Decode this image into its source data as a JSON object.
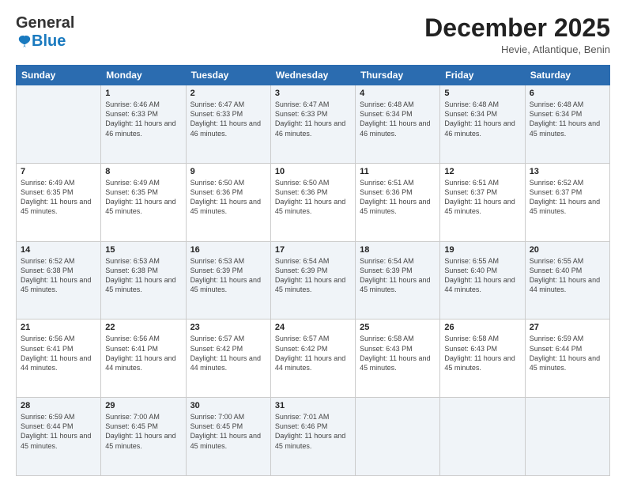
{
  "logo": {
    "general": "General",
    "blue": "Blue"
  },
  "title": "December 2025",
  "location": "Hevie, Atlantique, Benin",
  "days_of_week": [
    "Sunday",
    "Monday",
    "Tuesday",
    "Wednesday",
    "Thursday",
    "Friday",
    "Saturday"
  ],
  "weeks": [
    [
      {
        "day": "",
        "sunrise": "",
        "sunset": "",
        "daylight": ""
      },
      {
        "day": "1",
        "sunrise": "Sunrise: 6:46 AM",
        "sunset": "Sunset: 6:33 PM",
        "daylight": "Daylight: 11 hours and 46 minutes."
      },
      {
        "day": "2",
        "sunrise": "Sunrise: 6:47 AM",
        "sunset": "Sunset: 6:33 PM",
        "daylight": "Daylight: 11 hours and 46 minutes."
      },
      {
        "day": "3",
        "sunrise": "Sunrise: 6:47 AM",
        "sunset": "Sunset: 6:33 PM",
        "daylight": "Daylight: 11 hours and 46 minutes."
      },
      {
        "day": "4",
        "sunrise": "Sunrise: 6:48 AM",
        "sunset": "Sunset: 6:34 PM",
        "daylight": "Daylight: 11 hours and 46 minutes."
      },
      {
        "day": "5",
        "sunrise": "Sunrise: 6:48 AM",
        "sunset": "Sunset: 6:34 PM",
        "daylight": "Daylight: 11 hours and 46 minutes."
      },
      {
        "day": "6",
        "sunrise": "Sunrise: 6:48 AM",
        "sunset": "Sunset: 6:34 PM",
        "daylight": "Daylight: 11 hours and 45 minutes."
      }
    ],
    [
      {
        "day": "7",
        "sunrise": "Sunrise: 6:49 AM",
        "sunset": "Sunset: 6:35 PM",
        "daylight": "Daylight: 11 hours and 45 minutes."
      },
      {
        "day": "8",
        "sunrise": "Sunrise: 6:49 AM",
        "sunset": "Sunset: 6:35 PM",
        "daylight": "Daylight: 11 hours and 45 minutes."
      },
      {
        "day": "9",
        "sunrise": "Sunrise: 6:50 AM",
        "sunset": "Sunset: 6:36 PM",
        "daylight": "Daylight: 11 hours and 45 minutes."
      },
      {
        "day": "10",
        "sunrise": "Sunrise: 6:50 AM",
        "sunset": "Sunset: 6:36 PM",
        "daylight": "Daylight: 11 hours and 45 minutes."
      },
      {
        "day": "11",
        "sunrise": "Sunrise: 6:51 AM",
        "sunset": "Sunset: 6:36 PM",
        "daylight": "Daylight: 11 hours and 45 minutes."
      },
      {
        "day": "12",
        "sunrise": "Sunrise: 6:51 AM",
        "sunset": "Sunset: 6:37 PM",
        "daylight": "Daylight: 11 hours and 45 minutes."
      },
      {
        "day": "13",
        "sunrise": "Sunrise: 6:52 AM",
        "sunset": "Sunset: 6:37 PM",
        "daylight": "Daylight: 11 hours and 45 minutes."
      }
    ],
    [
      {
        "day": "14",
        "sunrise": "Sunrise: 6:52 AM",
        "sunset": "Sunset: 6:38 PM",
        "daylight": "Daylight: 11 hours and 45 minutes."
      },
      {
        "day": "15",
        "sunrise": "Sunrise: 6:53 AM",
        "sunset": "Sunset: 6:38 PM",
        "daylight": "Daylight: 11 hours and 45 minutes."
      },
      {
        "day": "16",
        "sunrise": "Sunrise: 6:53 AM",
        "sunset": "Sunset: 6:39 PM",
        "daylight": "Daylight: 11 hours and 45 minutes."
      },
      {
        "day": "17",
        "sunrise": "Sunrise: 6:54 AM",
        "sunset": "Sunset: 6:39 PM",
        "daylight": "Daylight: 11 hours and 45 minutes."
      },
      {
        "day": "18",
        "sunrise": "Sunrise: 6:54 AM",
        "sunset": "Sunset: 6:39 PM",
        "daylight": "Daylight: 11 hours and 45 minutes."
      },
      {
        "day": "19",
        "sunrise": "Sunrise: 6:55 AM",
        "sunset": "Sunset: 6:40 PM",
        "daylight": "Daylight: 11 hours and 44 minutes."
      },
      {
        "day": "20",
        "sunrise": "Sunrise: 6:55 AM",
        "sunset": "Sunset: 6:40 PM",
        "daylight": "Daylight: 11 hours and 44 minutes."
      }
    ],
    [
      {
        "day": "21",
        "sunrise": "Sunrise: 6:56 AM",
        "sunset": "Sunset: 6:41 PM",
        "daylight": "Daylight: 11 hours and 44 minutes."
      },
      {
        "day": "22",
        "sunrise": "Sunrise: 6:56 AM",
        "sunset": "Sunset: 6:41 PM",
        "daylight": "Daylight: 11 hours and 44 minutes."
      },
      {
        "day": "23",
        "sunrise": "Sunrise: 6:57 AM",
        "sunset": "Sunset: 6:42 PM",
        "daylight": "Daylight: 11 hours and 44 minutes."
      },
      {
        "day": "24",
        "sunrise": "Sunrise: 6:57 AM",
        "sunset": "Sunset: 6:42 PM",
        "daylight": "Daylight: 11 hours and 44 minutes."
      },
      {
        "day": "25",
        "sunrise": "Sunrise: 6:58 AM",
        "sunset": "Sunset: 6:43 PM",
        "daylight": "Daylight: 11 hours and 45 minutes."
      },
      {
        "day": "26",
        "sunrise": "Sunrise: 6:58 AM",
        "sunset": "Sunset: 6:43 PM",
        "daylight": "Daylight: 11 hours and 45 minutes."
      },
      {
        "day": "27",
        "sunrise": "Sunrise: 6:59 AM",
        "sunset": "Sunset: 6:44 PM",
        "daylight": "Daylight: 11 hours and 45 minutes."
      }
    ],
    [
      {
        "day": "28",
        "sunrise": "Sunrise: 6:59 AM",
        "sunset": "Sunset: 6:44 PM",
        "daylight": "Daylight: 11 hours and 45 minutes."
      },
      {
        "day": "29",
        "sunrise": "Sunrise: 7:00 AM",
        "sunset": "Sunset: 6:45 PM",
        "daylight": "Daylight: 11 hours and 45 minutes."
      },
      {
        "day": "30",
        "sunrise": "Sunrise: 7:00 AM",
        "sunset": "Sunset: 6:45 PM",
        "daylight": "Daylight: 11 hours and 45 minutes."
      },
      {
        "day": "31",
        "sunrise": "Sunrise: 7:01 AM",
        "sunset": "Sunset: 6:46 PM",
        "daylight": "Daylight: 11 hours and 45 minutes."
      },
      {
        "day": "",
        "sunrise": "",
        "sunset": "",
        "daylight": ""
      },
      {
        "day": "",
        "sunrise": "",
        "sunset": "",
        "daylight": ""
      },
      {
        "day": "",
        "sunrise": "",
        "sunset": "",
        "daylight": ""
      }
    ]
  ]
}
